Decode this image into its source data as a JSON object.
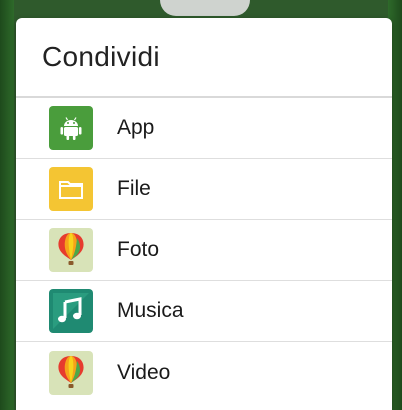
{
  "dialog": {
    "title": "Condividi",
    "items": [
      {
        "label": "App",
        "icon": "android-icon",
        "color": "#4a9d3c"
      },
      {
        "label": "File",
        "icon": "folder-icon",
        "color": "#f4c533"
      },
      {
        "label": "Foto",
        "icon": "photo-balloon-icon",
        "color": "#d8e3b8"
      },
      {
        "label": "Musica",
        "icon": "music-note-icon",
        "color": "#1f8a72"
      },
      {
        "label": "Video",
        "icon": "video-balloon-icon",
        "color": "#d8e3b8"
      }
    ]
  }
}
